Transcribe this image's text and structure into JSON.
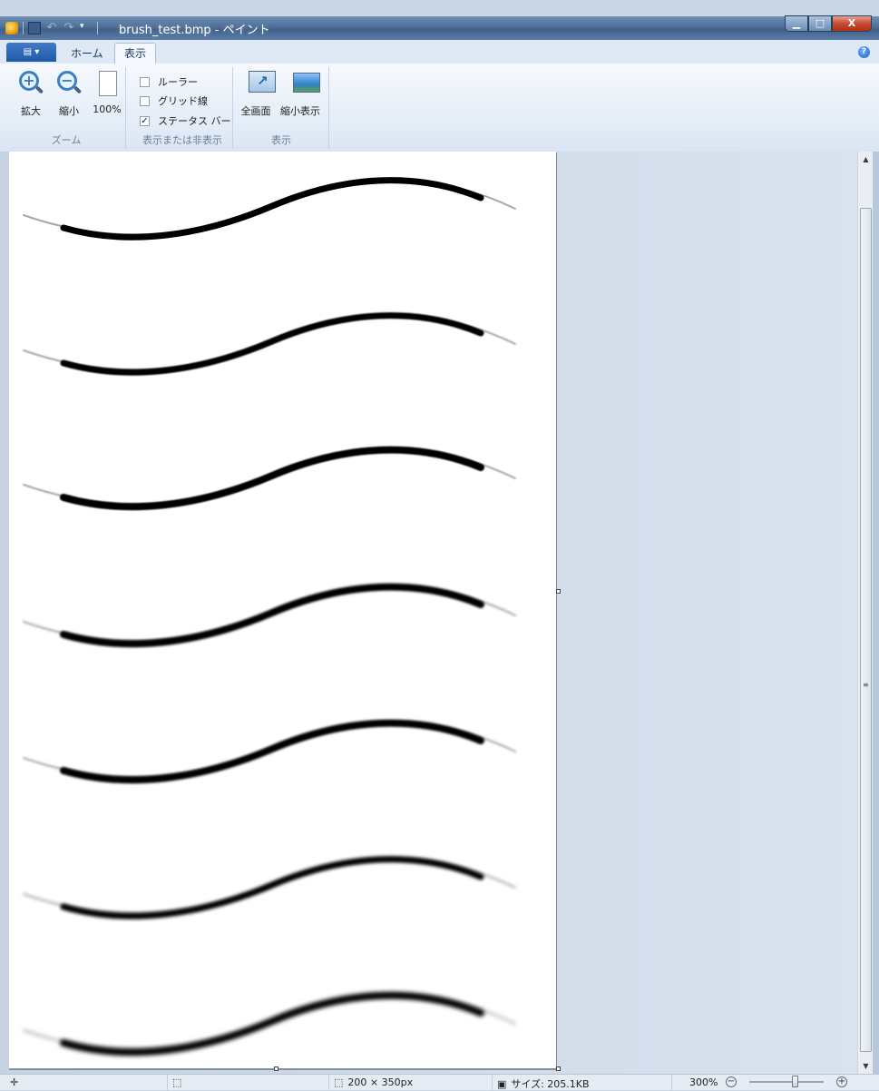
{
  "window": {
    "title": "brush_test.bmp - ペイント",
    "minimize": "▁",
    "maximize": "□",
    "close": "X"
  },
  "qat": {
    "undo": "↶",
    "redo": "↷",
    "customize": "▾"
  },
  "ribbon": {
    "app_menu": "▤ ▾",
    "tabs": {
      "home": "ホーム",
      "view": "表示"
    },
    "help": "?",
    "zoom_group": {
      "label": "ズーム",
      "zoom_in": "拡大",
      "zoom_out": "縮小",
      "actual_size": "100%"
    },
    "show_hide_group": {
      "label": "表示または非表示",
      "ruler": {
        "label": "ルーラー",
        "checked": false
      },
      "gridlines": {
        "label": "グリッド線",
        "checked": false
      },
      "status_bar": {
        "label": "ステータス バー",
        "checked": true,
        "mark": "✓"
      }
    },
    "display_group": {
      "label": "表示",
      "full_screen": "全画面",
      "thumbnail": "縮小表示"
    }
  },
  "canvas": {
    "stroke_count": 7,
    "stroke_color": "#000000"
  },
  "scrollbar": {
    "up": "▲",
    "down": "▼",
    "grip": "≡"
  },
  "statusbar": {
    "cursor_icon": "✛",
    "selection_icon": "⬚",
    "dimensions": "200 × 350px",
    "file_size": "サイズ: 205.1KB",
    "zoom_level": "300%",
    "zoom_out": "−",
    "zoom_in": "+",
    "zoom_percent": 300
  }
}
